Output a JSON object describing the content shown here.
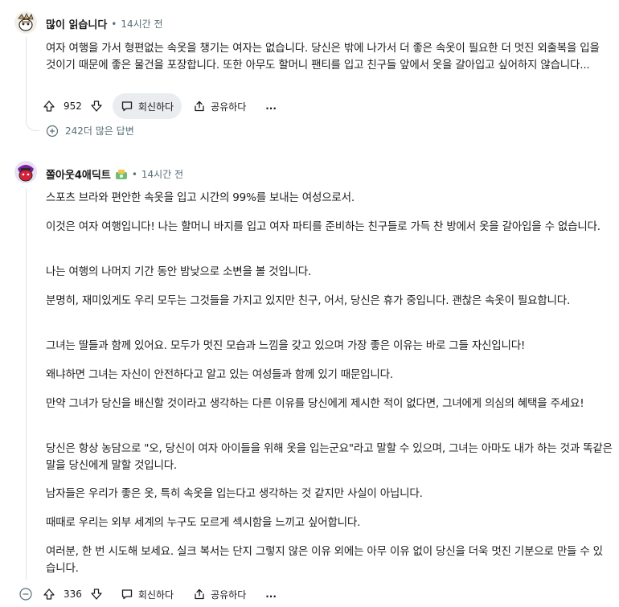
{
  "comments": [
    {
      "author": "많이 읽습니다",
      "separator": "•",
      "time": "14시간 전",
      "paragraphs": [
        "여자 여행을 가서 형편없는 속옷을 챙기는 여자는 없습니다. 당신은 밖에 나가서 더 좋은 속옷이 필요한 더 멋진 외출복을 입을 것이기 때문에 좋은 물건을 포장합니다. 또한 아무도 할머니 팬티를 입고 친구들 앞에서 옷을 갈아입고 싶어하지 않습니다..."
      ],
      "votes": "952",
      "reply_label": "회신하다",
      "share_label": "공유하다",
      "more_label": "...",
      "more_replies": "242더 많은 답변"
    },
    {
      "author": "쫄아웃4애딕트",
      "separator": "•",
      "time": "14시간 전",
      "paragraphs": [
        "스포츠 브라와 편안한 속옷을 입고 시간의 99%를 보내는 여성으로서.",
        "이것은 여자 여행입니다! 나는 할머니 바지를 입고 여자 파티를 준비하는 친구들로 가득 찬 방에서 옷을 갈아입을 수 없습니다.",
        "나는 여행의 나머지 기간 동안 밤낮으로 소변을 볼 것입니다.",
        "분명히, 재미있게도 우리 모두는 그것들을 가지고 있지만 친구, 어서, 당신은 휴가 중입니다. 괜찮은 속옷이 필요합니다.",
        "그녀는 딸들과 함께 있어요. 모두가 멋진 모습과 느낌을 갖고 있으며 가장 좋은 이유는 바로 그들 자신입니다!",
        "왜냐하면 그녀는 자신이 안전하다고 알고 있는 여성들과 함께 있기 때문입니다.",
        "만약 그녀가 당신을 배신할 것이라고 생각하는 다른 이유를 당신에게 제시한 적이 없다면, 그녀에게 의심의 혜택을 주세요!",
        "당신은 항상 농담으로 \"오, 당신이 여자 아이들을 위해 옷을 입는군요\"라고 말할 수 있으며, 그녀는 아마도 내가 하는 것과 똑같은 말을 당신에게 말할 것입니다.",
        "남자들은 우리가 좋은 옷, 특히 속옷을 입는다고 생각하는 것 같지만 사실이 아닙니다.",
        "때때로 우리는 외부 세계의 누구도 모르게 섹시함을 느끼고 싶어합니다.",
        "여러분, 한 번 시도해 보세요. 실크 복서는 단지 그렇지 않은 이유 외에는 아무 이유 없이 당신을 더욱 멋진 기분으로 만들 수 있습니다."
      ],
      "votes": "336",
      "reply_label": "회신하다",
      "share_label": "공유하다",
      "more_label": "..."
    }
  ]
}
